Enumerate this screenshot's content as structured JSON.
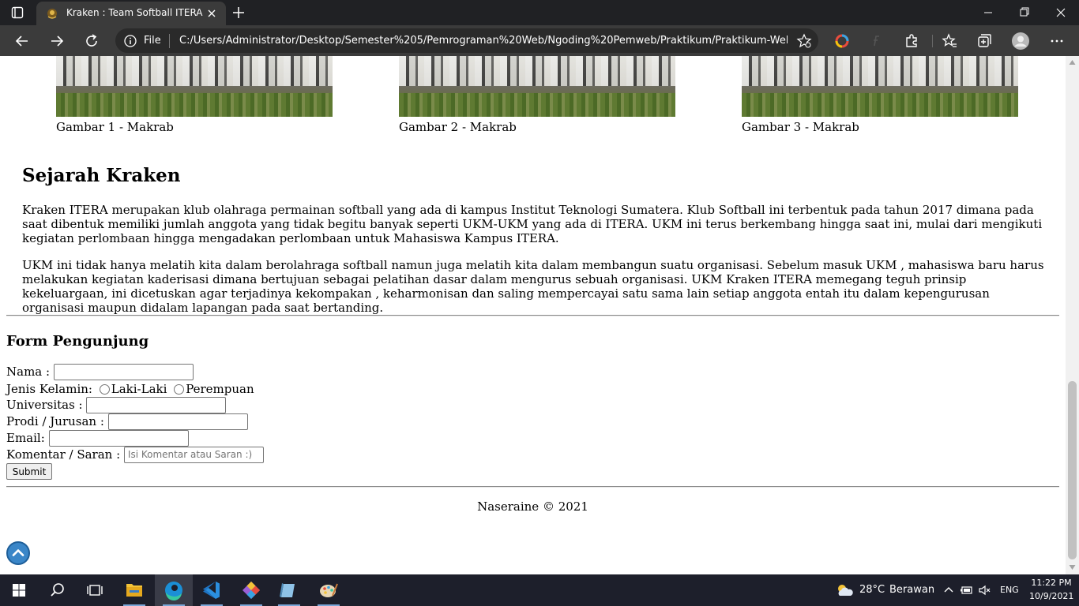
{
  "browser": {
    "tab_title": "Kraken : Team Softball ITERA",
    "omnibox_scheme": "File",
    "omnibox_url": "C:/Users/Administrator/Desktop/Semester%205/Pemrograman%20Web/Ngoding%20Pemweb/Praktikum/Praktikum-Web-..."
  },
  "gallery": [
    {
      "caption": "Gambar 1 - Makrab"
    },
    {
      "caption": "Gambar 2 - Makrab"
    },
    {
      "caption": "Gambar 3 - Makrab"
    }
  ],
  "history": {
    "title": "Sejarah Kraken",
    "paragraphs": [
      "Kraken ITERA merupakan klub olahraga permainan softball yang ada di kampus Institut Teknologi Sumatera. Klub Softball ini terbentuk pada tahun 2017 dimana pada saat dibentuk memiliki jumlah anggota yang tidak begitu banyak seperti UKM-UKM yang ada di ITERA. UKM ini terus berkembang hingga saat ini, mulai dari mengikuti kegiatan perlombaan hingga mengadakan perlombaan untuk Mahasiswa Kampus ITERA.",
      "UKM ini tidak hanya melatih kita dalam berolahraga softball namun juga melatih kita dalam membangun suatu organisasi. Sebelum masuk UKM , mahasiswa baru harus melakukan kegiatan kaderisasi dimana bertujuan sebagai pelatihan dasar dalam mengurus sebuah organisasi. UKM Kraken ITERA memegang teguh prinsip kekeluargaan, ini dicetuskan agar terjadinya kekompakan , keharmonisan dan saling mempercayai satu sama lain setiap anggota entah itu dalam kepengurusan organisasi maupun didalam lapangan pada saat bertanding."
    ]
  },
  "form": {
    "title": "Form Pengunjung",
    "nama_label": "Nama :",
    "gender_label": "Jenis Kelamin:",
    "gender_male": "Laki-Laki",
    "gender_female": "Perempuan",
    "univ_label": "Universitas :",
    "prodi_label": "Prodi / Jurusan :",
    "email_label": "Email:",
    "komentar_label": "Komentar / Saran :",
    "komentar_placeholder": "Isi Komentar atau Saran :)",
    "submit_label": "Submit"
  },
  "footer": {
    "text": "Naseraine © 2021"
  },
  "taskbar": {
    "weather_temp": "28°C",
    "weather_condition": "Berawan",
    "language": "ENG",
    "time": "11:22 PM",
    "date": "10/9/2021"
  },
  "colors": {
    "titlebar": "#202124",
    "toolbar": "#3b3b3b",
    "taskbar": "#1d1f2b",
    "back_to_top": "#3a86c8"
  }
}
